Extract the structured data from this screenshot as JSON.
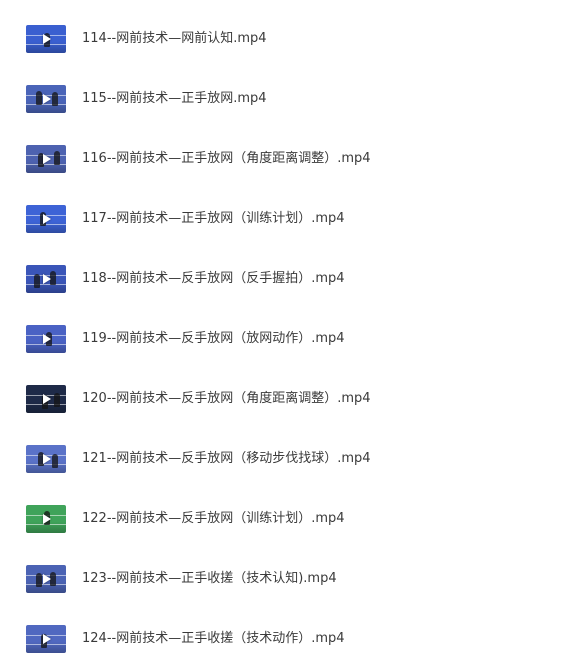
{
  "files": [
    {
      "name": "114--网前技术—网前认知.mp4",
      "thumb_icon": "video-thumbnail-icon",
      "thumb_bg": "#3a5fd0"
    },
    {
      "name": "115--网前技术—正手放网.mp4",
      "thumb_icon": "video-thumbnail-icon",
      "thumb_bg": "#4a64b8"
    },
    {
      "name": "116--网前技术—正手放网（角度距离调整）.mp4",
      "thumb_icon": "video-thumbnail-icon",
      "thumb_bg": "#4d62b0"
    },
    {
      "name": "117--网前技术—正手放网（训练计划）.mp4",
      "thumb_icon": "video-thumbnail-icon",
      "thumb_bg": "#3d63d6"
    },
    {
      "name": "118--网前技术—反手放网（反手握拍）.mp4",
      "thumb_icon": "video-thumbnail-icon",
      "thumb_bg": "#3a55b8"
    },
    {
      "name": "119--网前技术—反手放网（放网动作）.mp4",
      "thumb_icon": "video-thumbnail-icon",
      "thumb_bg": "#4a62c4"
    },
    {
      "name": "120--网前技术—反手放网（角度距离调整）.mp4",
      "thumb_icon": "video-thumbnail-icon",
      "thumb_bg": "#1e2a48"
    },
    {
      "name": "121--网前技术—反手放网（移动步伐找球）.mp4",
      "thumb_icon": "video-thumbnail-icon",
      "thumb_bg": "#5a72c8"
    },
    {
      "name": "122--网前技术—反手放网（训练计划）.mp4",
      "thumb_icon": "video-thumbnail-icon",
      "thumb_bg": "#3fa35a"
    },
    {
      "name": "123--网前技术—正手收搓（技术认知).mp4",
      "thumb_icon": "video-thumbnail-icon",
      "thumb_bg": "#4b63b4"
    },
    {
      "name": "124--网前技术—正手收搓（技术动作）.mp4",
      "thumb_icon": "video-thumbnail-icon",
      "thumb_bg": "#5068c0"
    }
  ],
  "play_icon": "play-icon",
  "colors": {
    "text": "#3a3a3a",
    "background": "#ffffff"
  }
}
